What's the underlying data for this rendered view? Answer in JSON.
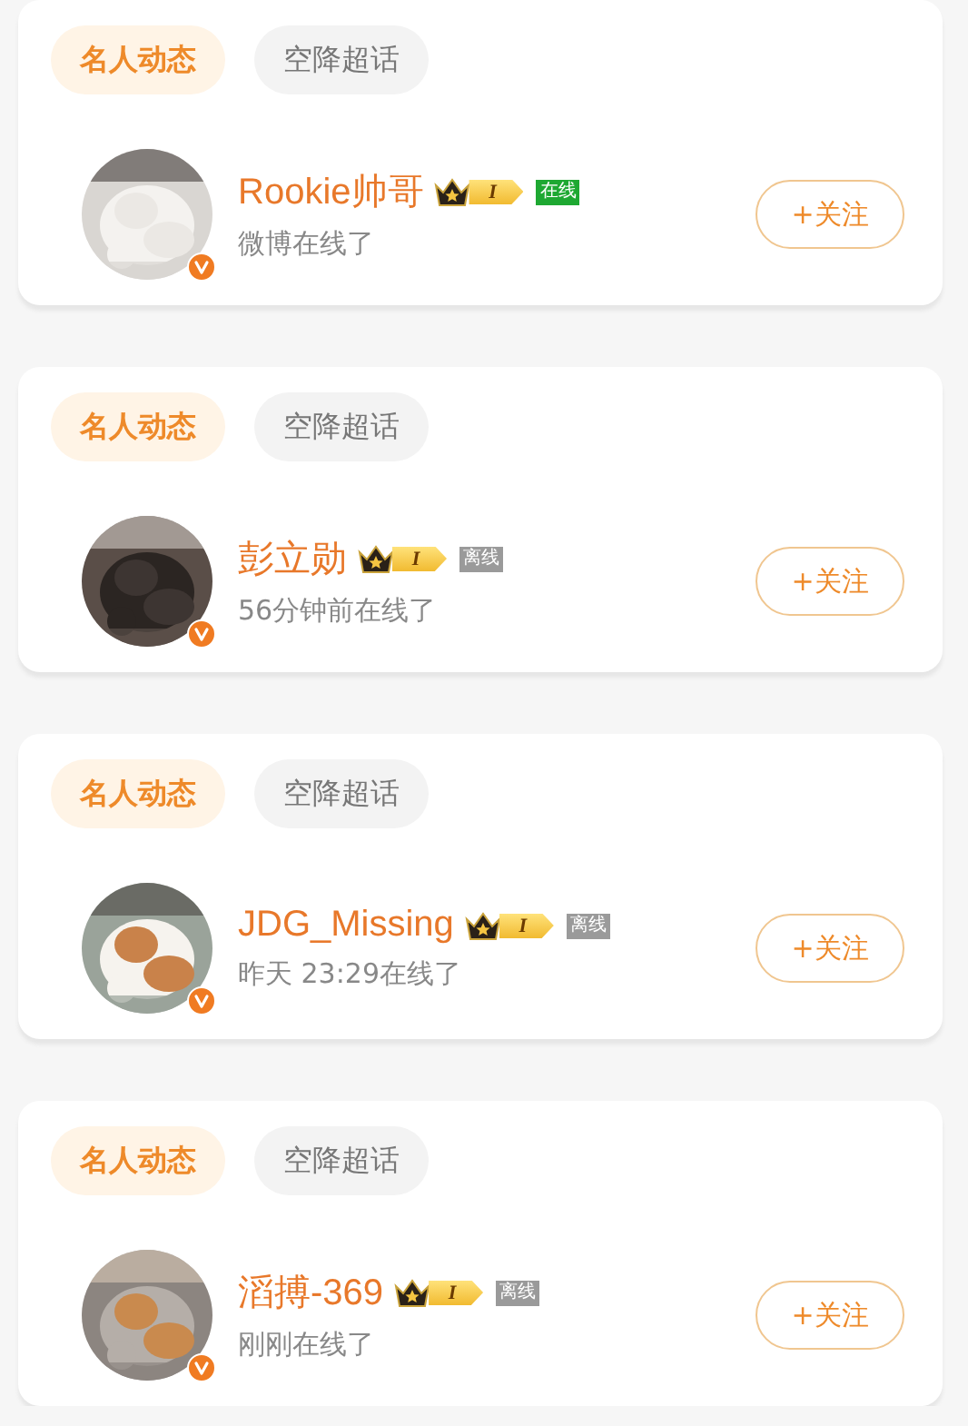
{
  "cards": [
    {
      "tabs": [
        {
          "label": "名人动态",
          "selected": true
        },
        {
          "label": "空降超话",
          "selected": false
        }
      ],
      "user": {
        "name": "Rookie帅哥",
        "level": "I",
        "status": "在线",
        "online": true,
        "activity": "微博在线了",
        "verified": true
      },
      "follow_button": "+关注"
    },
    {
      "tabs": [
        {
          "label": "名人动态",
          "selected": true
        },
        {
          "label": "空降超话",
          "selected": false
        }
      ],
      "user": {
        "name": "彭立勋",
        "level": "I",
        "status": "离线",
        "online": false,
        "activity": "56分钟前在线了",
        "verified": true
      },
      "follow_button": "+关注"
    },
    {
      "tabs": [
        {
          "label": "名人动态",
          "selected": true
        },
        {
          "label": "空降超话",
          "selected": false
        }
      ],
      "user": {
        "name": "JDG_Missing",
        "level": "I",
        "status": "离线",
        "online": false,
        "activity": "昨天 23:29在线了",
        "verified": true
      },
      "follow_button": "+关注"
    },
    {
      "tabs": [
        {
          "label": "名人动态",
          "selected": true
        },
        {
          "label": "空降超话",
          "selected": false
        }
      ],
      "user": {
        "name": "滔搏-369",
        "level": "I",
        "status": "离线",
        "online": false,
        "activity": "刚刚在线了",
        "verified": true
      },
      "follow_button": "+关注"
    }
  ]
}
